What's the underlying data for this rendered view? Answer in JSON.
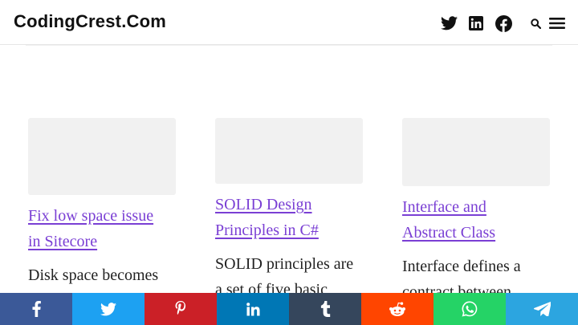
{
  "header": {
    "logo": "CodingCrest.Com",
    "icons": [
      "twitter-icon",
      "linkedin-icon",
      "facebook-icon",
      "search-icon",
      "hamburger-menu-icon"
    ]
  },
  "posts": [
    {
      "title_line1": "Fix low space issue",
      "title_line2": "in Sitecore",
      "excerpt": "Disk space becomes"
    },
    {
      "title_line1": "SOLID Design",
      "title_line2": "Principles in C#",
      "excerpt": "SOLID principles are a set of five basic"
    },
    {
      "title_line1": "Interface and",
      "title_line2": "Abstract Class",
      "excerpt": "Interface defines a contract between"
    }
  ],
  "share_bar": [
    {
      "name": "facebook",
      "icon": "facebook-icon",
      "color": "#3b5998"
    },
    {
      "name": "twitter",
      "icon": "twitter-icon",
      "color": "#1da1f2"
    },
    {
      "name": "pinterest",
      "icon": "pinterest-icon",
      "color": "#cb2027"
    },
    {
      "name": "linkedin",
      "icon": "linkedin-icon",
      "color": "#0077b5"
    },
    {
      "name": "tumblr",
      "icon": "tumblr-icon",
      "color": "#35465c"
    },
    {
      "name": "reddit",
      "icon": "reddit-icon",
      "color": "#ff4500"
    },
    {
      "name": "whatsapp",
      "icon": "whatsapp-icon",
      "color": "#25d366"
    },
    {
      "name": "telegram",
      "icon": "telegram-icon",
      "color": "#2ca5e0"
    }
  ],
  "colors": {
    "link": "#7a3fd4",
    "thumbnail": "#f1f1f1",
    "logo": "#111111"
  }
}
